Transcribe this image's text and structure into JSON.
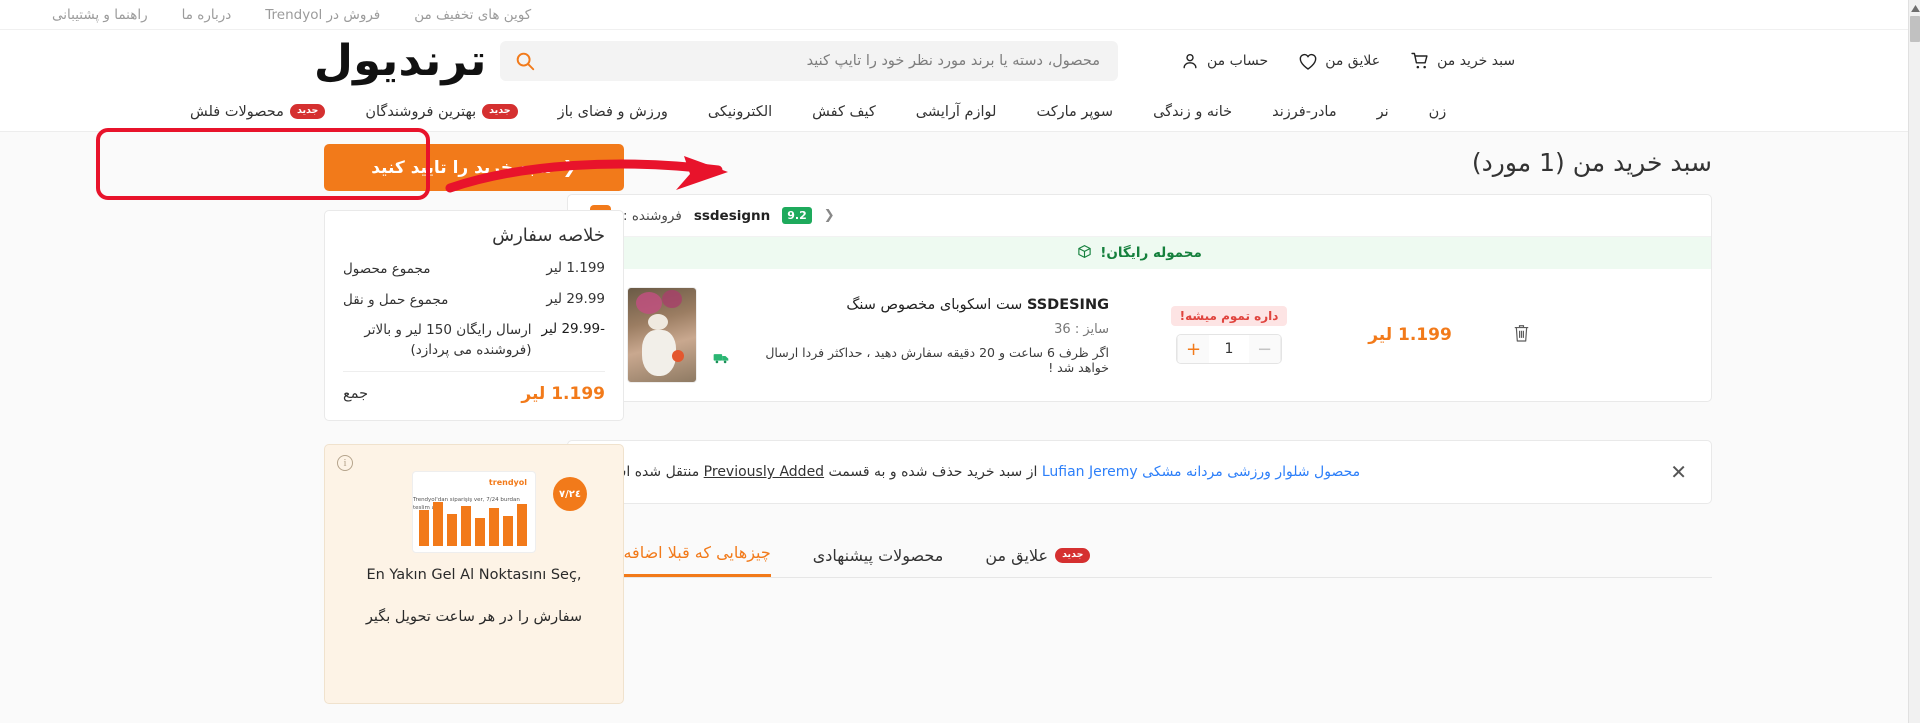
{
  "topbar": {
    "items": [
      {
        "label": "راهنما و پشتیبانی",
        "name": "help-support"
      },
      {
        "label": "درباره ما",
        "name": "about-us"
      },
      {
        "label": "فروش در Trendyol",
        "name": "sell-on-trendyol"
      },
      {
        "label": "کوین های تخفیف من",
        "name": "my-discount-coins"
      }
    ]
  },
  "header": {
    "logo": "ترندیول",
    "search": {
      "placeholder": "محصول، دسته یا برند مورد نظر خود را تایپ کنید",
      "value": "",
      "icon": "search-icon"
    },
    "actions": [
      {
        "label": "حساب من",
        "icon": "user-icon",
        "name": "account"
      },
      {
        "label": "علایق من",
        "icon": "heart-icon",
        "name": "favorites"
      },
      {
        "label": "سبد خرید من",
        "icon": "cart-icon",
        "name": "cart"
      }
    ]
  },
  "nav": {
    "items": [
      {
        "label": "محصولات فلش",
        "badge": "جدید"
      },
      {
        "label": "بهترین فروشندگان",
        "badge": "جدید"
      },
      {
        "label": "ورزش و فضای باز",
        "badge": ""
      },
      {
        "label": "الکترونیکی",
        "badge": ""
      },
      {
        "label": "کیف کفش",
        "badge": ""
      },
      {
        "label": "لوازم آرایشی",
        "badge": ""
      },
      {
        "label": "سوپر مارکت",
        "badge": ""
      },
      {
        "label": "خانه و زندگی",
        "badge": ""
      },
      {
        "label": "مادر-فرزند",
        "badge": ""
      },
      {
        "label": "نر",
        "badge": ""
      },
      {
        "label": "زن",
        "badge": ""
      }
    ]
  },
  "cart": {
    "title": "سبد خرید من (1 مورد)",
    "confirm_button": "سبد خرید را تایید کنید",
    "confirm_chevron": "❮",
    "seller": {
      "prefix": "فروشنده :",
      "name": "ssdesignn",
      "score": "9.2",
      "chevron": "❮"
    },
    "free_shipping": "محموله رایگان!",
    "product": {
      "brand": "SSDESING",
      "name": "ست اسکوبای مخصوص سنگ",
      "size": "سایز : 36",
      "shipping_note": "اگر ظرف 6 ساعت و 20 دقیقه سفارش دهید ، حداکثر فردا ارسال خواهد شد !",
      "stock_badge": "داره تموم میشه!",
      "quantity": "1",
      "minus": "−",
      "plus": "+",
      "price": "1.199 لیر",
      "delete_icon": "trash-icon"
    },
    "notice": {
      "text_part1": "محصول شلوار ورزشی مردانه مشکی",
      "brand": "Lufian Jeremy",
      "text_part2": "از سبد خرید حذف شده و به قسمت",
      "link": "Previously Added",
      "text_part3": "منتقل شده است .",
      "close": "✕"
    },
    "tabs": [
      {
        "label": "چیزهایی که قبلا اضافه کرده ام",
        "active": true,
        "badge": ""
      },
      {
        "label": "محصولات پیشنهادی",
        "active": false,
        "badge": ""
      },
      {
        "label": "علایق من",
        "active": false,
        "badge": "جدید"
      }
    ]
  },
  "summary": {
    "title": "خلاصه سفارش",
    "rows": [
      {
        "label": "مجموع محصول",
        "value": "1.199 لیر"
      },
      {
        "label": "مجموع حمل و نقل",
        "value": "29.99 لیر"
      },
      {
        "label": "ارسال رایگان 150 لیر و بالاتر (فروشنده می پردازد)",
        "value": "-29.99 لیر"
      }
    ],
    "total_label": "جمع",
    "total_value": "1.199 لیر"
  },
  "promo": {
    "info_icon": "ⓘ",
    "badge": "٧/٢٤",
    "brand": "trendyol",
    "mini_text": "Trendyol'dan\nsiparişiş ver,\n7/24 burdan\nteslim al.",
    "line1": "En Yakın Gel Al Noktasını Seç,",
    "line2": "سفارش را در هر ساعت تحویل بگیر"
  },
  "colors": {
    "accent": "#f27a1a",
    "annotation": "#e8132b",
    "badge_red": "#d53030",
    "green": "#1eaa5c",
    "link_blue": "#2d7ff9"
  }
}
